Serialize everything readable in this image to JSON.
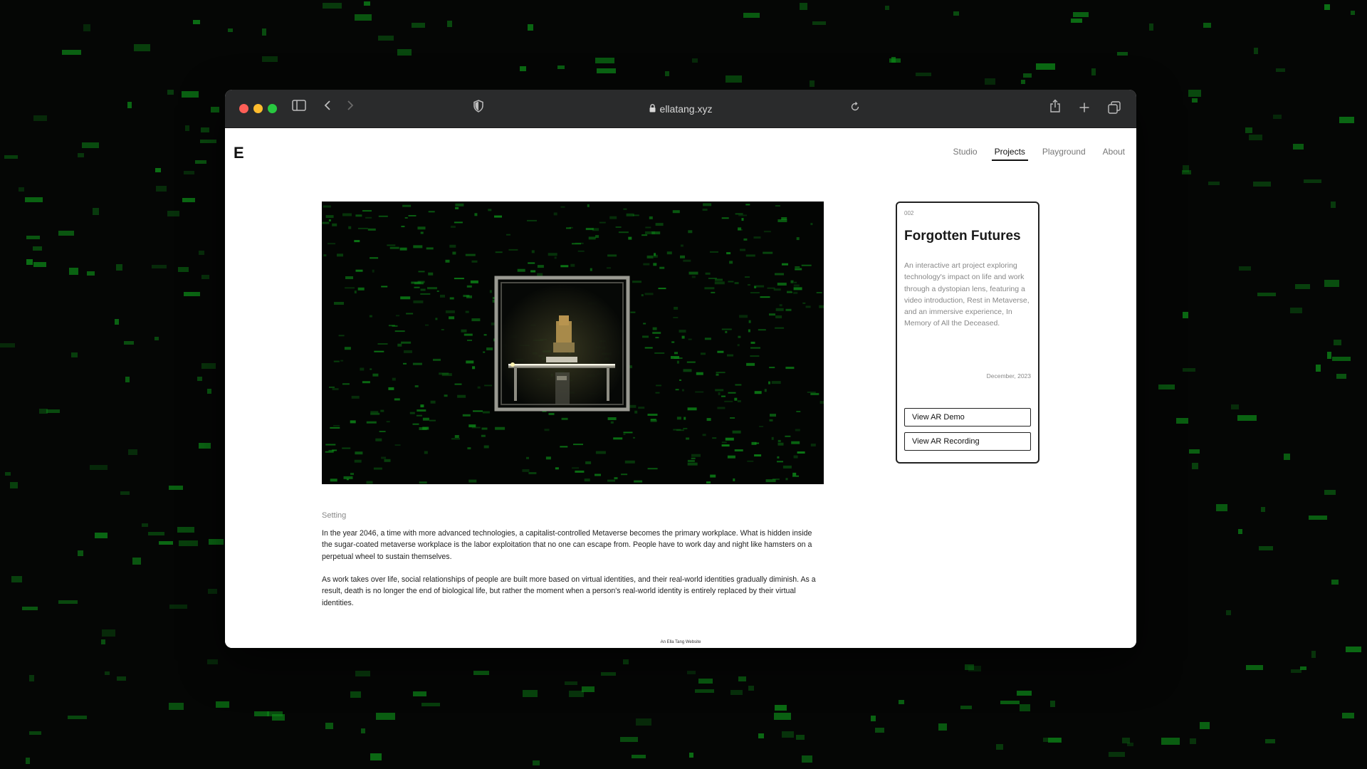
{
  "browser": {
    "url": "ellatang.xyz",
    "icons": [
      "sidebar-icon",
      "back-icon",
      "forward-icon",
      "shield-icon",
      "lock-icon",
      "reload-icon",
      "share-icon",
      "new-tab-icon",
      "tabs-overview-icon"
    ]
  },
  "site": {
    "logo": "E",
    "nav": [
      {
        "label": "Studio",
        "active": false
      },
      {
        "label": "Projects",
        "active": true
      },
      {
        "label": "Playground",
        "active": false
      },
      {
        "label": "About",
        "active": false
      }
    ]
  },
  "project": {
    "number": "002",
    "title": "Forgotten Futures",
    "description": "An interactive art project exploring technology's impact on life and work through a dystopian lens, featuring a video introduction, Rest in Metaverse, and an immersive experience, In Memory of All the Deceased.",
    "date": "December, 2023",
    "buttons": [
      "View AR Demo",
      "View AR Recording"
    ]
  },
  "content": {
    "section_label": "Setting",
    "paragraphs": [
      "In the year 2046, a time with more advanced technologies, a capitalist-controlled Metaverse becomes the primary workplace. What is hidden inside the sugar-coated metaverse workplace is the labor exploitation that no one can escape from. People have to work day and night like hamsters on a perpetual wheel to sustain themselves.",
      "As work takes over life, social relationships of people are built more based on virtual identities, and their real-world identities gradually diminish. As a result, death is no longer the end of biological life, but rather the moment when a person's real-world identity is entirely replaced by their virtual identities."
    ]
  },
  "footer": "An Ella Tang Website",
  "colors": {
    "background": "#050605",
    "accent_green": "#0d8a18",
    "toolbar": "#2a2b2c"
  }
}
